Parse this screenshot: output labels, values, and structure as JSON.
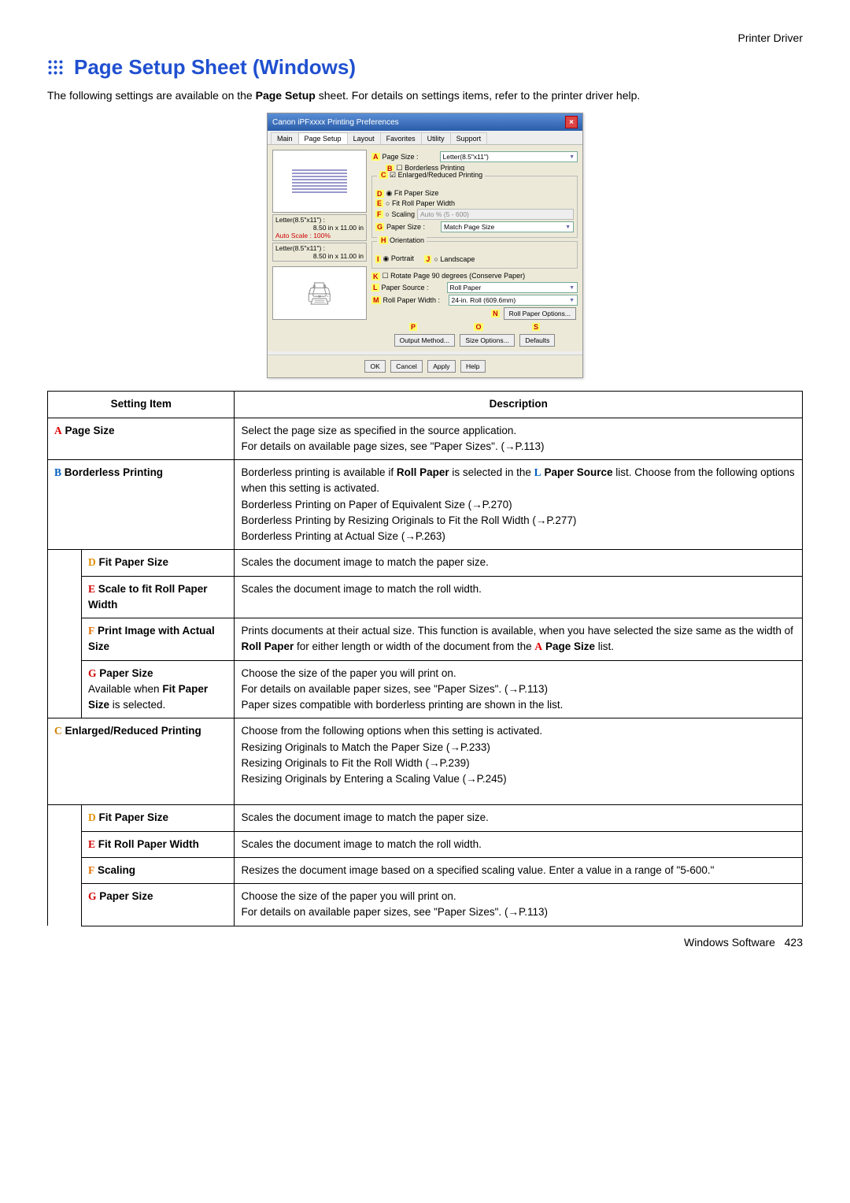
{
  "header": {
    "section": "Printer Driver"
  },
  "page": {
    "title": "Page Setup Sheet (Windows)",
    "intro_pre": "The following settings are available on the ",
    "intro_sheet": "Page Setup",
    "intro_post": " sheet.  For details on settings items, refer to the printer driver help."
  },
  "screenshot": {
    "titlebar": "Canon iPFxxxx Printing Preferences",
    "tabs": [
      "Main",
      "Page Setup",
      "Layout",
      "Favorites",
      "Utility",
      "Support"
    ],
    "left": {
      "letter_line1": "Letter(8.5\"x11\") :",
      "letter_dim1": "8.50 in x 11.00 in",
      "autoscale": "Auto Scale : 100%",
      "letter_line2": "Letter(8.5\"x11\") :",
      "letter_dim2": "8.50 in x 11.00 in",
      "printer_placeholder": "🖨"
    },
    "right": {
      "page_size_label": "Page Size :",
      "page_size_value": "Letter(8.5\"x11\")",
      "borderless": "Borderless Printing",
      "enlarge_group": "Enlarged/Reduced Printing",
      "fit_paper": "Fit Paper Size",
      "fit_roll": "Fit Roll Paper Width",
      "scaling": "Scaling",
      "scaling_value": "Auto  %  (5 - 600)",
      "paper_size_label": "Paper Size :",
      "paper_size_value": "Match Page Size",
      "orientation_group": "Orientation",
      "portrait": "Portrait",
      "landscape": "Landscape",
      "rotate": "Rotate Page 90 degrees (Conserve Paper)",
      "paper_source_label": "Paper Source :",
      "paper_source_value": "Roll Paper",
      "roll_width_label": "Roll Paper Width :",
      "roll_width_value": "24-in. Roll (609.6mm)",
      "roll_options": "Roll Paper Options...",
      "output_method": "Output Method...",
      "size_options": "Size Options...",
      "defaults": "Defaults",
      "ok": "OK",
      "cancel": "Cancel",
      "apply": "Apply",
      "help": "Help"
    },
    "markers": {
      "A": "A",
      "B": "B",
      "C": "C",
      "D": "D",
      "E": "E",
      "F": "F",
      "G": "G",
      "H": "H",
      "I": "I",
      "J": "J",
      "K": "K",
      "L": "L",
      "M": "M",
      "N": "N",
      "O": "O",
      "P": "P",
      "S": "S"
    }
  },
  "table": {
    "head_setting": "Setting Item",
    "head_desc": "Description",
    "rows": {
      "A": {
        "letter": "A",
        "name": "Page Size",
        "desc": "Select the page size as specified in the source application.\nFor details on available page sizes, see \"Paper Sizes\". (→P.113)"
      },
      "B": {
        "letter": "B",
        "name": "Borderless Printing",
        "desc_pre": "Borderless printing is available if ",
        "desc_b1": "Roll Paper",
        "desc_mid": " is selected in the ",
        "desc_l": "L",
        "desc_b2": "Paper Source",
        "desc_post": " list.  Choose from the following options when this setting is activated.\nBorderless Printing on Paper of Equivalent Size (→P.270)\nBorderless Printing by Resizing Originals to Fit the Roll Width (→P.277)\nBorderless Printing at Actual Size (→P.263)"
      },
      "D": {
        "letter": "D",
        "name": "Fit Paper Size",
        "desc": "Scales the document image to match the paper size."
      },
      "E": {
        "letter": "E",
        "name": "Scale to fit Roll Paper Width",
        "desc": "Scales the document image to match the roll width."
      },
      "F": {
        "letter": "F",
        "name": "Print Image with Actual Size",
        "desc_pre": "Prints documents at their actual size. This function is available, when you have selected the size same as the width of ",
        "desc_b": "Roll Paper",
        "desc_mid": " for either length or width of the document from the ",
        "desc_a": "A",
        "desc_b2": "Page Size",
        "desc_post": " list."
      },
      "G": {
        "letter": "G",
        "name": "Paper Size",
        "sub_pre": "Available when ",
        "sub_b": "Fit Paper Size",
        "sub_post": " is selected.",
        "desc": "Choose the size of the paper you will print on.\nFor details on available paper sizes, see \"Paper Sizes\". (→P.113)\nPaper sizes compatible with borderless printing are shown in the list."
      },
      "C": {
        "letter": "C",
        "name": "Enlarged/Reduced Printing",
        "desc": "Choose from the following options when this setting is activated.\nResizing Originals to Match the Paper Size (→P.233)\nResizing Originals to Fit the Roll Width (→P.239)\nResizing Originals by Entering a Scaling Value (→P.245)"
      },
      "D2": {
        "letter": "D",
        "name": "Fit Paper Size",
        "desc": "Scales the document image to match the paper size."
      },
      "E2": {
        "letter": "E",
        "name": "Fit Roll Paper Width",
        "desc": "Scales the document image to match the roll width."
      },
      "F2": {
        "letter": "F",
        "name": "Scaling",
        "desc": "Resizes the document image based on a specified scaling value. Enter a value in a range of \"5-600.\""
      },
      "G2": {
        "letter": "G",
        "name": "Paper Size",
        "desc": "Choose the size of the paper you will print on.\nFor details on available paper sizes, see \"Paper Sizes\". (→P.113)"
      }
    }
  },
  "footer": {
    "left": "Windows Software",
    "page": "423"
  }
}
